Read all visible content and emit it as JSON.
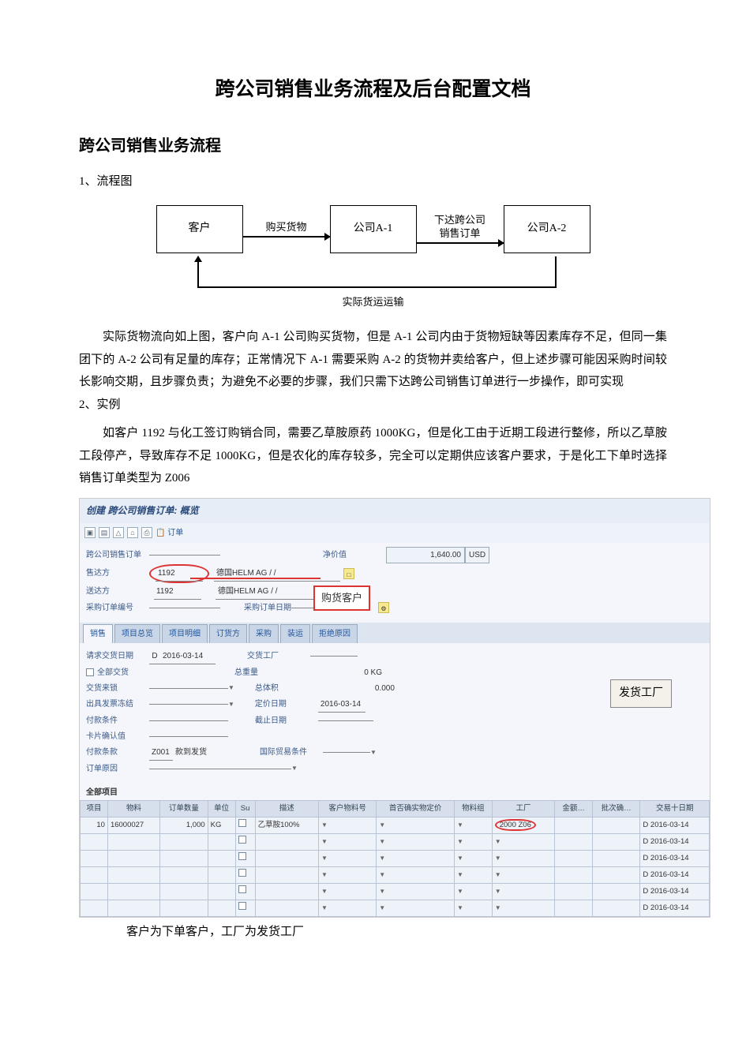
{
  "doc": {
    "title": "跨公司销售业务流程及后台配置文档",
    "section1": "跨公司销售业务流程",
    "s1_1": "1、流程图",
    "diagram": {
      "box1": "客户",
      "arrow1": "购买货物",
      "box2": "公司A-1",
      "arrow2": "下达跨公司\n销售订单",
      "box3": "公司A-2",
      "return_label": "实际货运运输"
    },
    "para1": "实际货物流向如上图，客户向 A-1 公司购买货物，但是 A-1 公司内由于货物短缺等因素库存不足，但同一集团下的 A-2 公司有足量的库存；正常情况下 A-1 需要采购 A-2 的货物并卖给客户，但上述步骤可能因采购时间较长影响交期，且步骤负责；为避免不必要的步骤，我们只需下达跨公司销售订单进行一步操作，即可实现",
    "s1_2": "2、实例",
    "para2": "如客户 1192 与化工签订购销合同，需要乙草胺原药 1000KG，但是化工由于近期工段进行整修，所以乙草胺工段停产，导致库存不足 1000KG，但是农化的库存较多，完全可以定期供应该客户要求，于是化工下单时选择销售订单类型为 Z006",
    "final_caption": "客户为下单客户，工厂为发货工厂"
  },
  "sap": {
    "window_title": "创建 跨公司销售订单: 概览",
    "order_btn": "订单",
    "header": {
      "f_order": "跨公司销售订单",
      "f_soldto": "售达方",
      "f_shipto": "送达方",
      "f_ref": "采购订单编号",
      "soldto_val": "1192",
      "shipto_val": "1192",
      "party_text1": "德国HELM AG / /",
      "party_text2": "德国HELM AG / /",
      "net_label": "净价值",
      "net_value": "1,640.00",
      "net_curr": "USD",
      "ref_date_lbl": "采购订单日期"
    },
    "callout_buyer": "购货客户",
    "callout_plant": "发货工厂",
    "tabs": [
      "销售",
      "项目总览",
      "项目明细",
      "订货方",
      "采购",
      "装运",
      "拒绝原因"
    ],
    "pane": {
      "req_date_lbl": "请求交货日期",
      "req_date_type": "D",
      "req_date": "2016-03-14",
      "deliver_plant_lbl": "交货工厂",
      "full_deliv_lbl": "全部交货",
      "total_weight_lbl": "总重量",
      "total_weight_unit": "0 KG",
      "block_lbl": "交货来锁",
      "volume_lbl": "总体积",
      "volume_val": "0.000",
      "bill_block_lbl": "出具发票冻结",
      "price_date_lbl": "定价日期",
      "price_date": "2016-03-14",
      "pay_cond_lbl": "付款条件",
      "end_date_lbl": "截止日期",
      "card_lbl": "卡片确认值",
      "incoterm_lbl": "付款条款",
      "incoterm_code": "Z001",
      "incoterm_text": "款到发货",
      "trade_lbl": "国际贸易条件",
      "reason_lbl": "订单原因"
    },
    "grid_title": "全部项目",
    "grid": {
      "cols": [
        "项目",
        "物料",
        "订单数量",
        "单位",
        "Su",
        "描述",
        "客户物料号",
        "首否确实物定价",
        "物料组",
        "工厂",
        "金额…",
        "批次确…",
        "交易十日期"
      ],
      "rows": [
        {
          "item": "10",
          "mat": "16000027",
          "qty": "1,000",
          "uom": "KG",
          "desc": "乙草胺100%",
          "plant": "2000 Z06",
          "date": "D 2016-03-14"
        },
        {
          "item": "",
          "mat": "",
          "qty": "",
          "uom": "",
          "desc": "",
          "plant": "",
          "date": "D 2016-03-14"
        },
        {
          "item": "",
          "mat": "",
          "qty": "",
          "uom": "",
          "desc": "",
          "plant": "",
          "date": "D 2016-03-14"
        },
        {
          "item": "",
          "mat": "",
          "qty": "",
          "uom": "",
          "desc": "",
          "plant": "",
          "date": "D 2016-03-14"
        },
        {
          "item": "",
          "mat": "",
          "qty": "",
          "uom": "",
          "desc": "",
          "plant": "",
          "date": "D 2016-03-14"
        },
        {
          "item": "",
          "mat": "",
          "qty": "",
          "uom": "",
          "desc": "",
          "plant": "",
          "date": "D 2016-03-14"
        }
      ]
    }
  }
}
